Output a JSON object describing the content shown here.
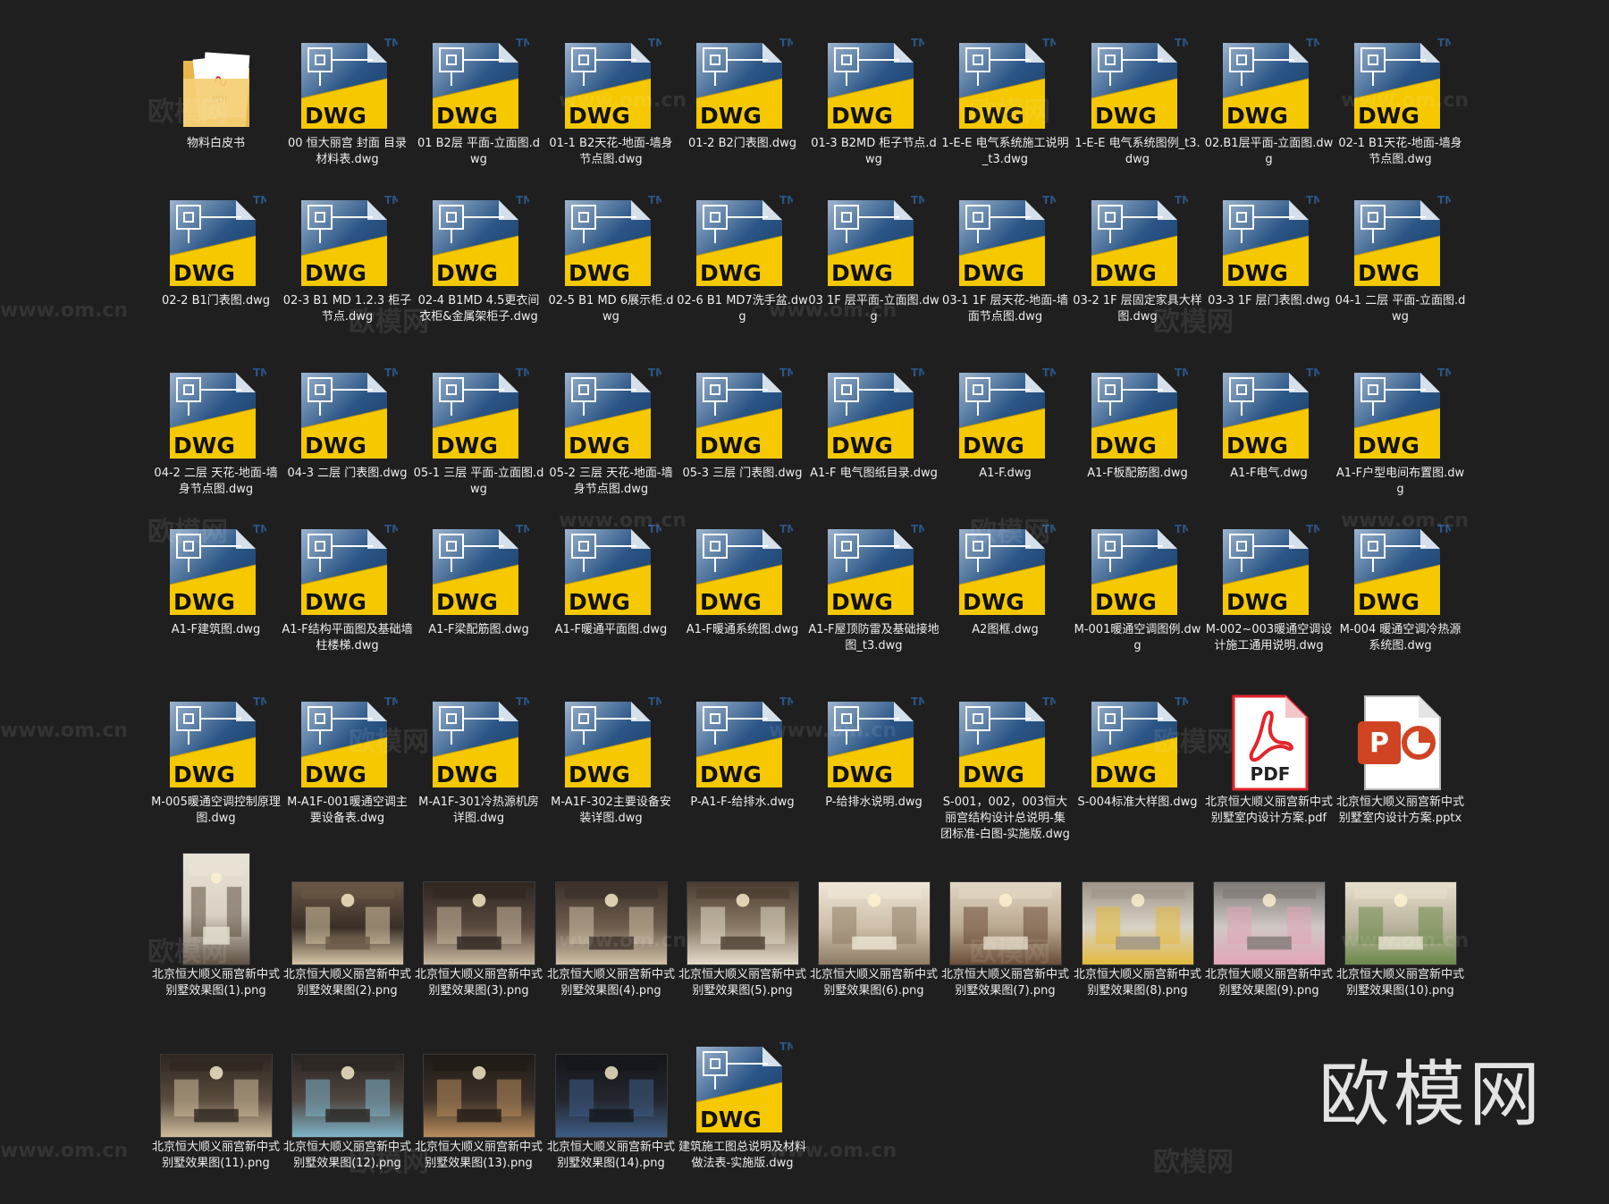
{
  "colors": {
    "background": "#1f1f1f",
    "dwg_yellow": "#f5c800",
    "dwg_blue": "#2a5585",
    "pdf_red": "#e3242b",
    "ppt_orange": "#d04423",
    "label_text": "#eeeeee"
  },
  "watermarks": [
    "欧模网",
    "www.om.cn"
  ],
  "brand_watermark": "欧模网",
  "files": [
    {
      "type": "folder",
      "name": "物料白皮书",
      "icon": "folder-icon"
    },
    {
      "type": "dwg",
      "name": "00 恒大丽宫 封面 目录 材料表.dwg",
      "icon": "dwg-file-icon"
    },
    {
      "type": "dwg",
      "name": "01 B2层 平面-立面图.dwg",
      "icon": "dwg-file-icon"
    },
    {
      "type": "dwg",
      "name": "01-1 B2天花-地面-墙身节点图.dwg",
      "icon": "dwg-file-icon"
    },
    {
      "type": "dwg",
      "name": "01-2 B2门表图.dwg",
      "icon": "dwg-file-icon"
    },
    {
      "type": "dwg",
      "name": "01-3 B2MD 柜子节点.dwg",
      "icon": "dwg-file-icon"
    },
    {
      "type": "dwg",
      "name": "1-E-E 电气系统施工说明_t3.dwg",
      "icon": "dwg-file-icon"
    },
    {
      "type": "dwg",
      "name": "1-E-E 电气系统图例_t3.dwg",
      "icon": "dwg-file-icon"
    },
    {
      "type": "dwg",
      "name": "02.B1层平面-立面图.dwg",
      "icon": "dwg-file-icon"
    },
    {
      "type": "dwg",
      "name": "02-1 B1天花-地面-墙身节点图.dwg",
      "icon": "dwg-file-icon"
    },
    {
      "type": "dwg",
      "name": "02-2 B1门表图.dwg",
      "icon": "dwg-file-icon"
    },
    {
      "type": "dwg",
      "name": "02-3 B1 MD 1.2.3 柜子节点.dwg",
      "icon": "dwg-file-icon"
    },
    {
      "type": "dwg",
      "name": "02-4 B1MD 4.5更衣间衣柜&金属架柜子.dwg",
      "icon": "dwg-file-icon"
    },
    {
      "type": "dwg",
      "name": "02-5 B1 MD 6展示柜.dwg",
      "icon": "dwg-file-icon"
    },
    {
      "type": "dwg",
      "name": "02-6 B1 MD7洗手盆.dwg",
      "icon": "dwg-file-icon"
    },
    {
      "type": "dwg",
      "name": "03 1F 层平面-立面图.dwg",
      "icon": "dwg-file-icon"
    },
    {
      "type": "dwg",
      "name": "03-1 1F 层天花-地面-墙面节点图.dwg",
      "icon": "dwg-file-icon"
    },
    {
      "type": "dwg",
      "name": "03-2 1F 层固定家具大样图.dwg",
      "icon": "dwg-file-icon"
    },
    {
      "type": "dwg",
      "name": "03-3 1F 层门表图.dwg",
      "icon": "dwg-file-icon"
    },
    {
      "type": "dwg",
      "name": "04-1 二层 平面-立面图.dwg",
      "icon": "dwg-file-icon"
    },
    {
      "type": "dwg",
      "name": "04-2 二层 天花-地面-墙身节点图.dwg",
      "icon": "dwg-file-icon"
    },
    {
      "type": "dwg",
      "name": "04-3 二层 门表图.dwg",
      "icon": "dwg-file-icon"
    },
    {
      "type": "dwg",
      "name": "05-1 三层 平面-立面图.dwg",
      "icon": "dwg-file-icon"
    },
    {
      "type": "dwg",
      "name": "05-2 三层 天花-地面-墙身节点图.dwg",
      "icon": "dwg-file-icon"
    },
    {
      "type": "dwg",
      "name": "05-3 三层 门表图.dwg",
      "icon": "dwg-file-icon"
    },
    {
      "type": "dwg",
      "name": "A1-F 电气图纸目录.dwg",
      "icon": "dwg-file-icon"
    },
    {
      "type": "dwg",
      "name": "A1-F.dwg",
      "icon": "dwg-file-icon"
    },
    {
      "type": "dwg",
      "name": "A1-F板配筋图.dwg",
      "icon": "dwg-file-icon"
    },
    {
      "type": "dwg",
      "name": "A1-F电气.dwg",
      "icon": "dwg-file-icon"
    },
    {
      "type": "dwg",
      "name": "A1-F户型电间布置图.dwg",
      "icon": "dwg-file-icon"
    },
    {
      "type": "dwg",
      "name": "A1-F建筑图.dwg",
      "icon": "dwg-file-icon"
    },
    {
      "type": "dwg",
      "name": "A1-F结构平面图及基础墙柱楼梯.dwg",
      "icon": "dwg-file-icon"
    },
    {
      "type": "dwg",
      "name": "A1-F梁配筋图.dwg",
      "icon": "dwg-file-icon"
    },
    {
      "type": "dwg",
      "name": "A1-F暖通平面图.dwg",
      "icon": "dwg-file-icon"
    },
    {
      "type": "dwg",
      "name": "A1-F暖通系统图.dwg",
      "icon": "dwg-file-icon"
    },
    {
      "type": "dwg",
      "name": "A1-F屋顶防雷及基础接地图_t3.dwg",
      "icon": "dwg-file-icon"
    },
    {
      "type": "dwg",
      "name": "A2图框.dwg",
      "icon": "dwg-file-icon"
    },
    {
      "type": "dwg",
      "name": "M-001暖通空调图例.dwg",
      "icon": "dwg-file-icon"
    },
    {
      "type": "dwg",
      "name": "M-002~003暖通空调设计施工通用说明.dwg",
      "icon": "dwg-file-icon"
    },
    {
      "type": "dwg",
      "name": "M-004 暖通空调冷热源系统图.dwg",
      "icon": "dwg-file-icon"
    },
    {
      "type": "dwg",
      "name": "M-005暖通空调控制原理图.dwg",
      "icon": "dwg-file-icon"
    },
    {
      "type": "dwg",
      "name": "M-A1F-001暖通空调主要设备表.dwg",
      "icon": "dwg-file-icon"
    },
    {
      "type": "dwg",
      "name": "M-A1F-301冷热源机房详图.dwg",
      "icon": "dwg-file-icon"
    },
    {
      "type": "dwg",
      "name": "M-A1F-302主要设备安装详图.dwg",
      "icon": "dwg-file-icon"
    },
    {
      "type": "dwg",
      "name": "P-A1-F-给排水.dwg",
      "icon": "dwg-file-icon"
    },
    {
      "type": "dwg",
      "name": "P-给排水说明.dwg",
      "icon": "dwg-file-icon"
    },
    {
      "type": "dwg",
      "name": "S-001，002，003恒大丽宫结构设计总说明-集团标准-白图-实施版.dwg",
      "icon": "dwg-file-icon"
    },
    {
      "type": "dwg",
      "name": "S-004标准大样图.dwg",
      "icon": "dwg-file-icon"
    },
    {
      "type": "pdf",
      "name": "北京恒大顺义丽宫新中式别墅室内设计方案.pdf",
      "icon": "pdf-file-icon"
    },
    {
      "type": "pptx",
      "name": "北京恒大顺义丽宫新中式别墅室内设计方案.pptx",
      "icon": "pptx-file-icon"
    },
    {
      "type": "image",
      "name": "北京恒大顺义丽宫新中式别墅效果图(1).png",
      "icon": "image-thumbnail",
      "aspect": "portrait",
      "palette": [
        "#d9d2c4",
        "#5e5144",
        "#e9e3d6"
      ]
    },
    {
      "type": "image",
      "name": "北京恒大顺义丽宫新中式别墅效果图(2).png",
      "icon": "image-thumbnail",
      "aspect": "landscape",
      "palette": [
        "#3a2e26",
        "#d8c7a6",
        "#6b5846"
      ]
    },
    {
      "type": "image",
      "name": "北京恒大顺义丽宫新中式别墅效果图(3).png",
      "icon": "image-thumbnail",
      "aspect": "landscape",
      "palette": [
        "#5a4a3f",
        "#c9b89e",
        "#2e2620"
      ]
    },
    {
      "type": "image",
      "name": "北京恒大顺义丽宫新中式别墅效果图(4).png",
      "icon": "image-thumbnail",
      "aspect": "landscape",
      "palette": [
        "#6e5d4d",
        "#cfc0a6",
        "#3b3029"
      ]
    },
    {
      "type": "image",
      "name": "北京恒大顺义丽宫新中式别墅效果图(5).png",
      "icon": "image-thumbnail",
      "aspect": "landscape",
      "palette": [
        "#8a7a66",
        "#e6dccb",
        "#4a3c30"
      ]
    },
    {
      "type": "image",
      "name": "北京恒大顺义丽宫新中式别墅效果图(6).png",
      "icon": "image-thumbnail",
      "aspect": "landscape",
      "palette": [
        "#cdbfa9",
        "#8e7b65",
        "#efe6d6"
      ]
    },
    {
      "type": "image",
      "name": "北京恒大顺义丽宫新中式别墅效果图(7).png",
      "icon": "image-thumbnail",
      "aspect": "landscape",
      "palette": [
        "#b9a88f",
        "#6b4d3a",
        "#e2d7c5"
      ]
    },
    {
      "type": "image",
      "name": "北京恒大顺义丽宫新中式别墅效果图(8).png",
      "icon": "image-thumbnail",
      "aspect": "landscape",
      "palette": [
        "#d8d2c6",
        "#e3b93c",
        "#9e9487"
      ]
    },
    {
      "type": "image",
      "name": "北京恒大顺义丽宫新中式别墅效果图(9).png",
      "icon": "image-thumbnail",
      "aspect": "landscape",
      "palette": [
        "#cfc8c4",
        "#e2a4b7",
        "#7f7a76"
      ]
    },
    {
      "type": "image",
      "name": "北京恒大顺义丽宫新中式别墅效果图(10).png",
      "icon": "image-thumbnail",
      "aspect": "landscape",
      "palette": [
        "#b9b39c",
        "#6b8a4a",
        "#e6e0cd"
      ]
    },
    {
      "type": "image",
      "name": "北京恒大顺义丽宫新中式别墅效果图(11).png",
      "icon": "image-thumbnail",
      "aspect": "landscape",
      "palette": [
        "#5b4c3e",
        "#cdbb9b",
        "#2d2520"
      ]
    },
    {
      "type": "image",
      "name": "北京恒大顺义丽宫新中式别墅效果图(12).png",
      "icon": "image-thumbnail",
      "aspect": "landscape",
      "palette": [
        "#4f4640",
        "#7db3c9",
        "#2a2522"
      ]
    },
    {
      "type": "image",
      "name": "北京恒大顺义丽宫新中式别墅效果图(13).png",
      "icon": "image-thumbnail",
      "aspect": "landscape",
      "palette": [
        "#3d3129",
        "#b88d5c",
        "#1f1a16"
      ]
    },
    {
      "type": "image",
      "name": "北京恒大顺义丽宫新中式别墅效果图(14).png",
      "icon": "image-thumbnail",
      "aspect": "landscape",
      "palette": [
        "#23262e",
        "#3e5d86",
        "#14161a"
      ]
    },
    {
      "type": "dwg",
      "name": "建筑施工图总说明及材料做法表-实施版.dwg",
      "icon": "dwg-file-icon"
    }
  ]
}
